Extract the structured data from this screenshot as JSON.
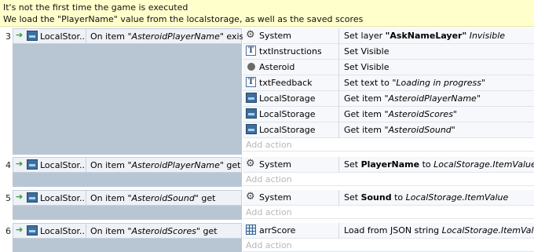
{
  "comment": {
    "line1": "It's not the first time the game is executed",
    "line2": "We load the \"PlayerName\" value from the localstorage, as well as the saved scores"
  },
  "add_action_label": "Add action",
  "events": [
    {
      "number": "3",
      "object": "LocalStor...",
      "condition_pre": "On item ",
      "condition_value": "\"AsteroidPlayerName\"",
      "condition_post": " exists",
      "actions": [
        {
          "icon": "gear-icon",
          "object": "System",
          "pre": "Set layer ",
          "bold": "\"AskNameLayer\"",
          "mid": " ",
          "italic": "Invisible",
          "post": ""
        },
        {
          "icon": "text-object-icon",
          "object": "txtInstructions",
          "pre": "Set Visible",
          "bold": "",
          "mid": "",
          "italic": "",
          "post": ""
        },
        {
          "icon": "asteroid-sprite-icon",
          "object": "Asteroid",
          "pre": "Set Visible",
          "bold": "",
          "mid": "",
          "italic": "",
          "post": ""
        },
        {
          "icon": "text-object-icon",
          "object": "txtFeedback",
          "pre": "Set text to ",
          "bold": "",
          "mid": "",
          "italic": "\"Loading in progress\"",
          "post": ""
        },
        {
          "icon": "localstorage-icon",
          "object": "LocalStorage",
          "pre": "Get item ",
          "bold": "",
          "mid": "",
          "italic": "\"AsteroidPlayerName\"",
          "post": ""
        },
        {
          "icon": "localstorage-icon",
          "object": "LocalStorage",
          "pre": "Get item ",
          "bold": "",
          "mid": "",
          "italic": "\"AsteroidScores\"",
          "post": ""
        },
        {
          "icon": "localstorage-icon",
          "object": "LocalStorage",
          "pre": "Get item ",
          "bold": "",
          "mid": "",
          "italic": "\"AsteroidSound\"",
          "post": ""
        }
      ]
    },
    {
      "number": "4",
      "object": "LocalStor...",
      "condition_pre": "On item ",
      "condition_value": "\"AsteroidPlayerName\"",
      "condition_post": " get",
      "actions": [
        {
          "icon": "gear-icon",
          "object": "System",
          "pre": "Set ",
          "bold": "PlayerName",
          "mid": " to ",
          "italic": "LocalStorage.ItemValue",
          "post": ""
        }
      ]
    },
    {
      "number": "5",
      "object": "LocalStor...",
      "condition_pre": "On item ",
      "condition_value": "\"AsteroidSound\"",
      "condition_post": " get",
      "actions": [
        {
          "icon": "gear-icon",
          "object": "System",
          "pre": "Set ",
          "bold": "Sound",
          "mid": " to ",
          "italic": "LocalStorage.ItemValue",
          "post": ""
        }
      ]
    },
    {
      "number": "6",
      "object": "LocalStor...",
      "condition_pre": "On item ",
      "condition_value": "\"AsteroidScores\"",
      "condition_post": " get",
      "actions": [
        {
          "icon": "array-icon",
          "object": "arrScore",
          "pre": "Load from JSON string ",
          "bold": "",
          "mid": "",
          "italic": "LocalStorage.ItemValue",
          "post": ""
        }
      ]
    }
  ]
}
